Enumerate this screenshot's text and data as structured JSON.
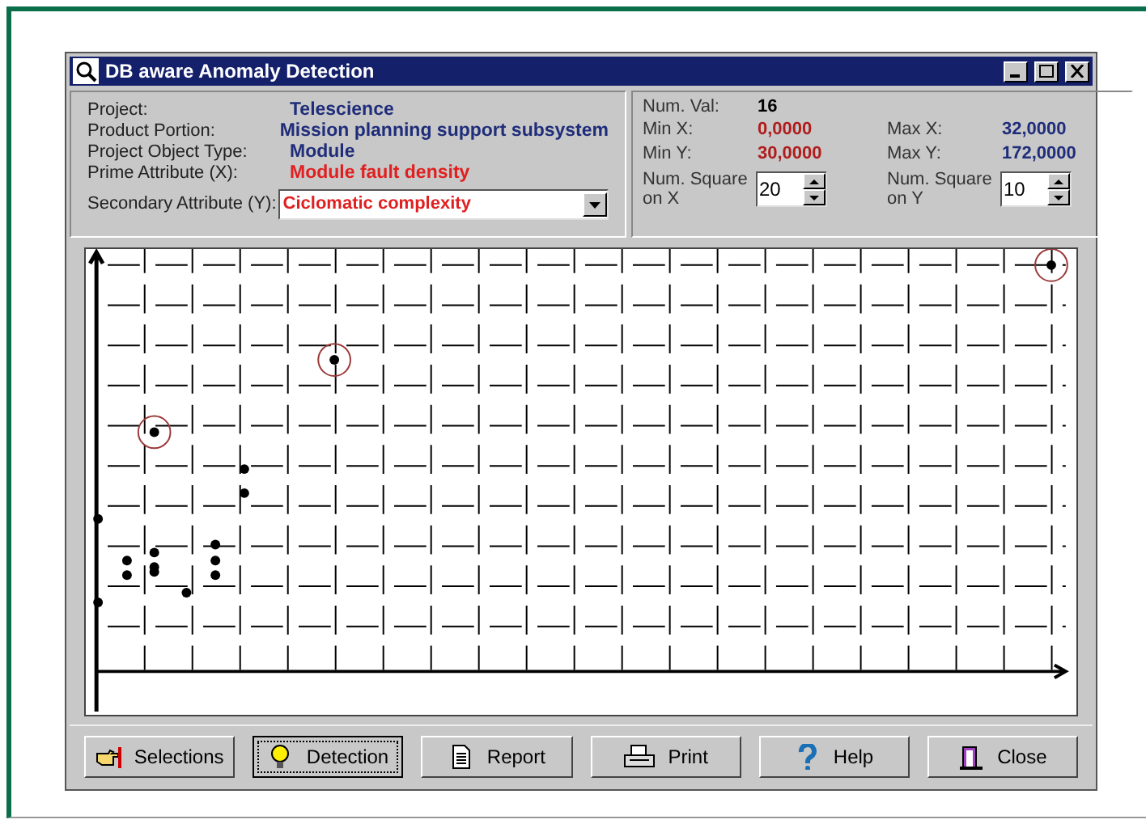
{
  "window": {
    "title": "DB aware Anomaly Detection"
  },
  "info": [
    {
      "label": "Project:",
      "value": "Telescience",
      "color": "#1f2d7a"
    },
    {
      "label": "Product Portion:",
      "value": "Mission planning support subsystem",
      "color": "#1f2d7a"
    },
    {
      "label": "Project Object Type:",
      "value": "Module",
      "color": "#1f2d7a"
    },
    {
      "label": "Prime Attribute (X):",
      "value": "Module fault density",
      "color": "#e02020"
    }
  ],
  "secondary": {
    "label": "Secondary Attribute (Y):",
    "value": "Ciclomatic complexity"
  },
  "num_val": {
    "label": "Num. Val:",
    "value": "16"
  },
  "stats": [
    {
      "label": "Min X:",
      "value": "0,0000",
      "color": "#b01c1c"
    },
    {
      "label": "Max X:",
      "value": "32,0000",
      "color": "#1f2d7a"
    },
    {
      "label": "Min Y:",
      "value": "30,0000",
      "color": "#b01c1c"
    },
    {
      "label": "Max Y:",
      "value": "172,0000",
      "color": "#1f2d7a"
    }
  ],
  "spinners": [
    {
      "label": "Num. Square on X",
      "value": "20"
    },
    {
      "label": "Num. Square on Y",
      "value": "10"
    }
  ],
  "buttons": [
    {
      "label": "Selections",
      "focused": false
    },
    {
      "label": "Detection",
      "focused": true
    },
    {
      "label": "Report",
      "focused": false
    },
    {
      "label": "Print",
      "focused": false
    },
    {
      "label": "Help",
      "focused": false
    },
    {
      "label": "Close",
      "focused": false
    }
  ]
}
